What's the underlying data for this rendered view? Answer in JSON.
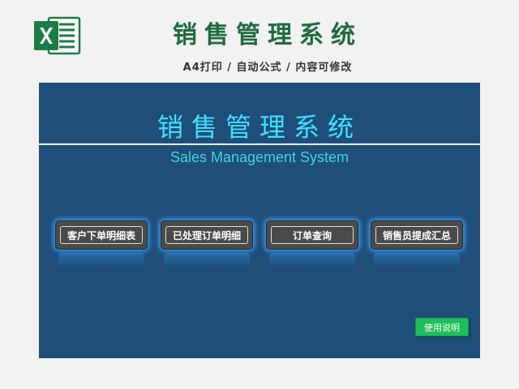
{
  "header": {
    "title": "销售管理系统",
    "subtitle": "A4打印 / 自动公式 / 内容可修改",
    "logo_icon": "excel-icon",
    "logo_color": "#1d7a45"
  },
  "panel": {
    "title": "销售管理系统",
    "subtitle": "Sales Management System",
    "background": "#1f4e79",
    "title_color": "#3fe0ff"
  },
  "buttons": [
    {
      "label": "客户下单明细表"
    },
    {
      "label": "已处理订单明细"
    },
    {
      "label": "订单查询"
    },
    {
      "label": "销售员提成汇总"
    }
  ],
  "help": {
    "label": "使用说明",
    "color": "#1fbe5a"
  }
}
